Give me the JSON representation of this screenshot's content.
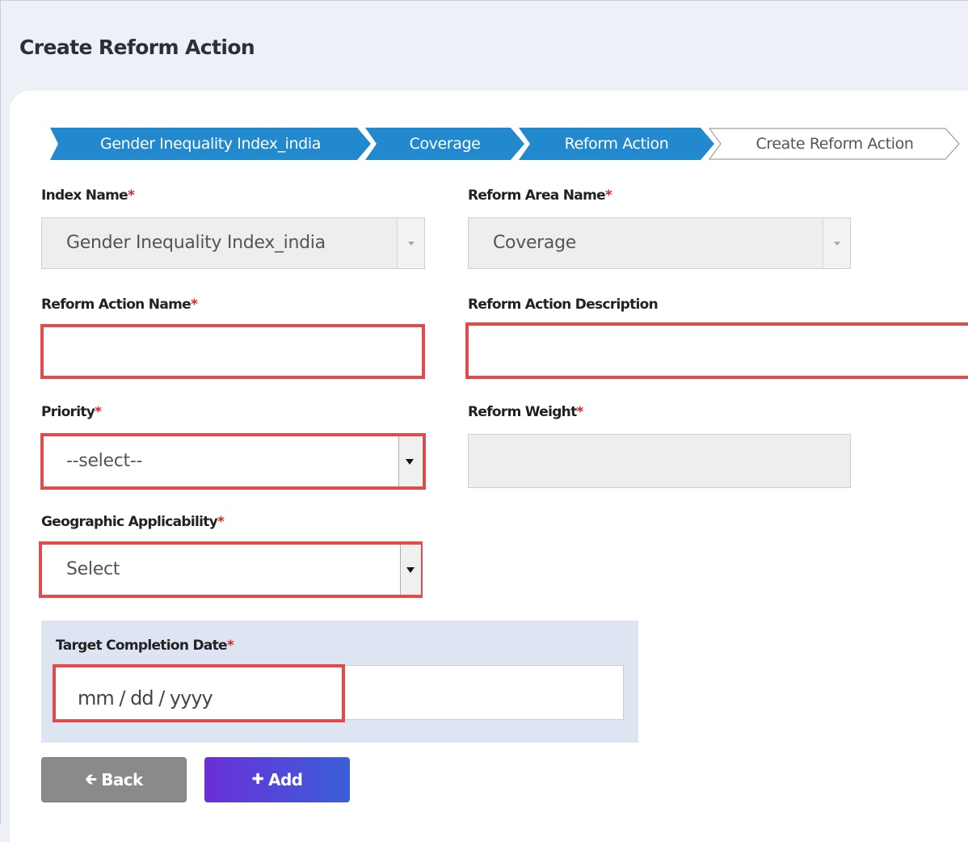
{
  "page": {
    "title": "Create Reform Action"
  },
  "breadcrumb": [
    {
      "label": "Gender Inequality Index_india",
      "state": "active"
    },
    {
      "label": "Coverage",
      "state": "active"
    },
    {
      "label": "Reform Action",
      "state": "active"
    },
    {
      "label": "Create Reform Action",
      "state": "current"
    }
  ],
  "form": {
    "index_name": {
      "label": "Index Name",
      "required_mark": "*",
      "value": "Gender Inequality Index_india"
    },
    "reform_area_name": {
      "label": "Reform Area Name",
      "required_mark": "*",
      "value": "Coverage"
    },
    "reform_action_name": {
      "label": "Reform Action Name",
      "required_mark": "*",
      "value": ""
    },
    "reform_action_description": {
      "label": "Reform Action Description",
      "value": ""
    },
    "priority": {
      "label": "Priority",
      "required_mark": "*",
      "value": "--select--"
    },
    "reform_weight": {
      "label": "Reform Weight",
      "required_mark": "*",
      "value": ""
    },
    "geographic_applicability": {
      "label": "Geographic Applicability",
      "required_mark": "*",
      "value": "Select"
    },
    "target_completion_date": {
      "label": "Target Completion Date",
      "required_mark": "*",
      "placeholder": "mm / dd / yyyy"
    }
  },
  "buttons": {
    "back": {
      "label": "Back",
      "icon": "arrow-left-icon"
    },
    "add": {
      "label": "Add",
      "icon": "plus-icon"
    }
  },
  "colors": {
    "breadcrumb_active": "#2389cf",
    "error_border": "#e24b4b",
    "required": "#d9232e",
    "date_panel": "#dde4f2"
  }
}
